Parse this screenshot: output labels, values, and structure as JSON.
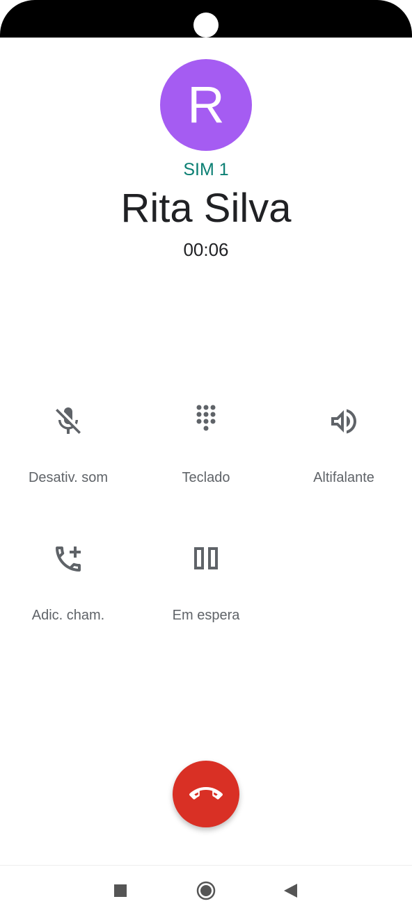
{
  "call": {
    "avatar_letter": "R",
    "sim": "SIM 1",
    "contact_name": "Rita Silva",
    "duration": "00:06"
  },
  "actions": {
    "mute": {
      "label": "Desativ. som",
      "icon": "mic-off-icon"
    },
    "keypad": {
      "label": "Teclado",
      "icon": "dialpad-icon"
    },
    "speaker": {
      "label": "Altifalante",
      "icon": "speaker-icon"
    },
    "add_call": {
      "label": "Adic. cham.",
      "icon": "add-call-icon"
    },
    "hold": {
      "label": "Em espera",
      "icon": "pause-icon"
    }
  },
  "end_call": {
    "icon": "call-end-icon",
    "color": "#d93025"
  },
  "navigation": {
    "recents": "square-icon",
    "home": "circle-icon",
    "back": "triangle-back-icon"
  },
  "colors": {
    "avatar": "#a55cf2",
    "sim_text": "#0b7f73",
    "icon": "#5f6368"
  }
}
